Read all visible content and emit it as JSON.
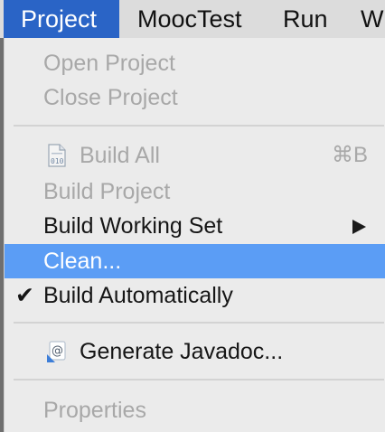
{
  "menubar": {
    "items": [
      {
        "label": "Project"
      },
      {
        "label": "MoocTest"
      },
      {
        "label": "Run"
      },
      {
        "label": "W"
      }
    ]
  },
  "menu": {
    "open_project": "Open Project",
    "close_project": "Close Project",
    "build_all": "Build All",
    "build_all_shortcut": "⌘B",
    "build_project": "Build Project",
    "build_working_set": "Build Working Set",
    "clean": "Clean...",
    "build_automatically": "Build Automatically",
    "build_automatically_check": "✔",
    "generate_javadoc": "Generate Javadoc...",
    "properties": "Properties"
  },
  "colors": {
    "active_menu": "#2a64c6",
    "highlight": "#5b9df5",
    "disabled_text": "#a8a8a8"
  },
  "icons": {
    "build_all": "binary-file-icon",
    "javadoc": "javadoc-icon",
    "submenu": "submenu-arrow-icon"
  }
}
